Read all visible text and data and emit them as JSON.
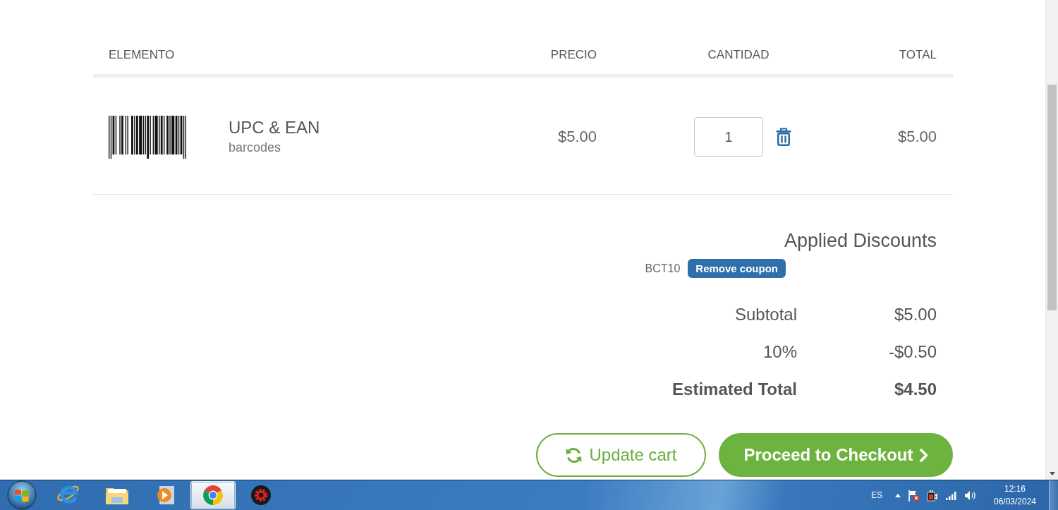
{
  "cart": {
    "columns": [
      "ELEMENTO",
      "PRECIO",
      "CANTIDAD",
      "TOTAL"
    ],
    "items": [
      {
        "name": "UPC & EAN",
        "category": "barcodes",
        "price": "$5.00",
        "quantity": "1",
        "total": "$5.00"
      }
    ]
  },
  "discounts": {
    "title": "Applied Discounts",
    "coupons": [
      {
        "code": "BCT10",
        "action": "Remove coupon"
      }
    ]
  },
  "summary": [
    {
      "label": "Subtotal",
      "value": "$5.00",
      "kind": "normal"
    },
    {
      "label": "10%",
      "value": "-$0.50",
      "kind": "normal"
    },
    {
      "label": "Estimated Total",
      "value": "$4.50",
      "kind": "total"
    }
  ],
  "actions": [
    {
      "label": "Update cart",
      "kind": "secondary"
    },
    {
      "label": "Proceed to Checkout",
      "kind": "primary"
    }
  ],
  "taskbar": {
    "apps": [
      {
        "kind": "letter",
        "selected": false
      },
      {
        "kind": "folder",
        "selected": false
      },
      {
        "kind": "player",
        "selected": false
      },
      {
        "kind": "wheel",
        "selected": true
      },
      {
        "kind": "gear",
        "selected": false
      }
    ],
    "tray": {
      "language": "ES",
      "time": "12:16",
      "date": "06/03/2024"
    }
  }
}
